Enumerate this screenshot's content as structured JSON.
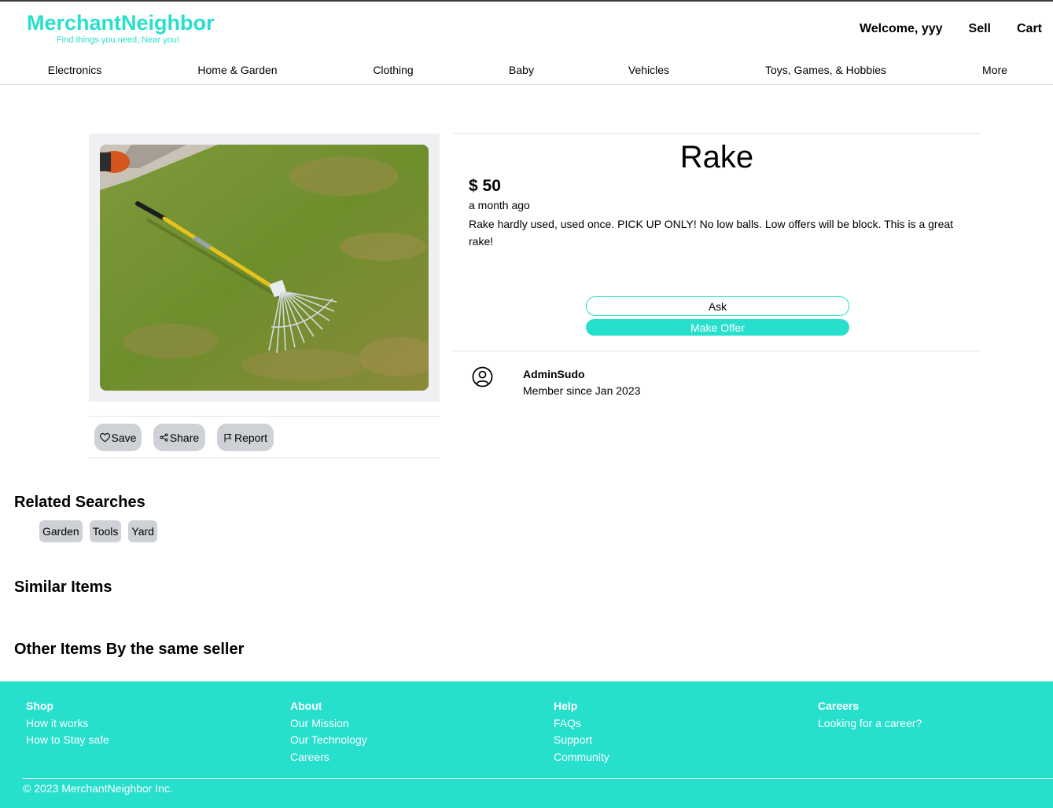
{
  "brand": {
    "name": "MerchantNeighbor",
    "tagline": "Find things you need, Near you!",
    "color": "#27dfcd"
  },
  "header": {
    "welcome": "Welcome, yyy",
    "sell": "Sell",
    "cart": "Cart"
  },
  "categories": [
    "Electronics",
    "Home & Garden",
    "Clothing",
    "Baby",
    "Vehicles",
    "Toys, Games, & Hobbies",
    "More"
  ],
  "listing": {
    "title": "Rake",
    "price": "$ 50",
    "posted": "a month ago",
    "description": "Rake hardly used, used once. PICK UP ONLY! No low balls. Low offers will be block. This is a great rake!",
    "ask_label": "Ask",
    "offer_label": "Make Offer",
    "image_icon": "rake-photo"
  },
  "actions": {
    "save": "Save",
    "share": "Share",
    "report": "Report"
  },
  "seller": {
    "name": "AdminSudo",
    "since": "Member since Jan 2023",
    "icon": "user-circle-icon"
  },
  "sections": {
    "related": "Related Searches",
    "similar": "Similar Items",
    "other": "Other Items By the same seller"
  },
  "related_tags": [
    "Garden",
    "Tools",
    "Yard"
  ],
  "footer": {
    "columns": [
      {
        "heading": "Shop",
        "links": [
          "How it works",
          "How to Stay safe"
        ]
      },
      {
        "heading": "About",
        "links": [
          "Our Mission",
          "Our Technology",
          "Careers"
        ]
      },
      {
        "heading": "Help",
        "links": [
          "FAQs",
          "Support",
          "Community"
        ]
      },
      {
        "heading": "Careers",
        "links": [
          "Looking for a career?"
        ]
      }
    ],
    "copyright": "© 2023 MerchantNeighbor Inc."
  }
}
